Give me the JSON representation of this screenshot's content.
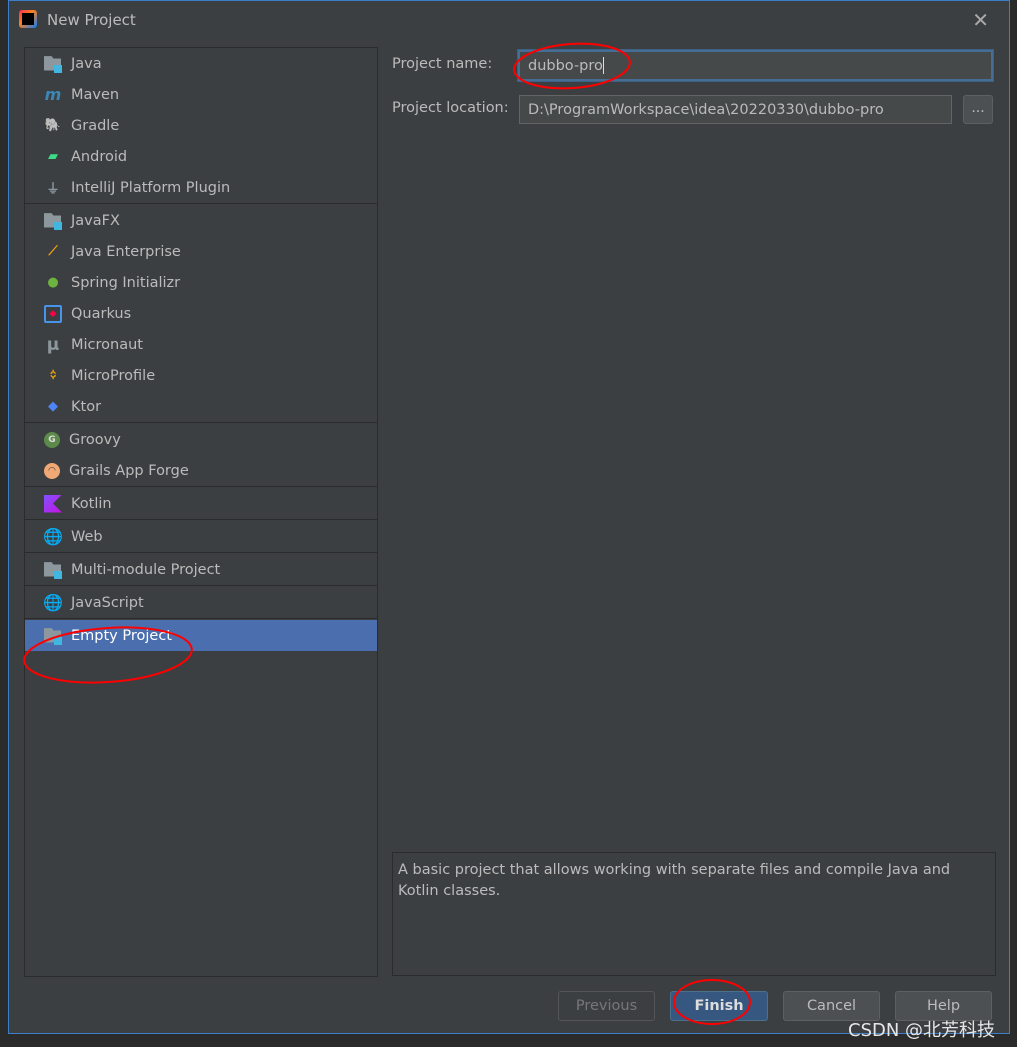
{
  "window": {
    "title": "New Project",
    "close_icon": "close-icon"
  },
  "sidebar": {
    "groups": [
      [
        {
          "label": "Java",
          "icon": "java-folder-icon"
        },
        {
          "label": "Maven",
          "icon": "maven-icon"
        },
        {
          "label": "Gradle",
          "icon": "gradle-elephant-icon"
        },
        {
          "label": "Android",
          "icon": "android-icon"
        },
        {
          "label": "IntelliJ Platform Plugin",
          "icon": "plugin-icon"
        }
      ],
      [
        {
          "label": "JavaFX",
          "icon": "javafx-folder-icon"
        },
        {
          "label": "Java Enterprise",
          "icon": "java-enterprise-icon"
        },
        {
          "label": "Spring Initializr",
          "icon": "spring-icon"
        },
        {
          "label": "Quarkus",
          "icon": "quarkus-icon"
        },
        {
          "label": "Micronaut",
          "icon": "micronaut-icon"
        },
        {
          "label": "MicroProfile",
          "icon": "microprofile-icon"
        },
        {
          "label": "Ktor",
          "icon": "ktor-icon"
        }
      ],
      [
        {
          "label": "Groovy",
          "icon": "groovy-icon"
        },
        {
          "label": "Grails App Forge",
          "icon": "grails-icon"
        }
      ],
      [
        {
          "label": "Kotlin",
          "icon": "kotlin-icon"
        }
      ],
      [
        {
          "label": "Web",
          "icon": "globe-icon"
        }
      ],
      [
        {
          "label": "Multi-module Project",
          "icon": "folder-icon"
        }
      ],
      [
        {
          "label": "JavaScript",
          "icon": "globe-icon"
        }
      ],
      [
        {
          "label": "Empty Project",
          "icon": "folder-icon",
          "selected": true
        }
      ]
    ]
  },
  "form": {
    "name_label": "Project name:",
    "name_value": "dubbo-pro",
    "location_label": "Project location:",
    "location_value": "D:\\ProgramWorkspace\\idea\\20220330\\dubbo-pro",
    "browse_label": "..."
  },
  "description": "A basic project that allows working with separate files and compile Java and Kotlin classes.",
  "buttons": {
    "previous": "Previous",
    "finish": "Finish",
    "cancel": "Cancel",
    "help": "Help"
  },
  "watermark": "CSDN @北芳科技",
  "colors": {
    "selection": "#4b6eaf",
    "annotation": "#ff0000",
    "primary_button": "#365880"
  }
}
